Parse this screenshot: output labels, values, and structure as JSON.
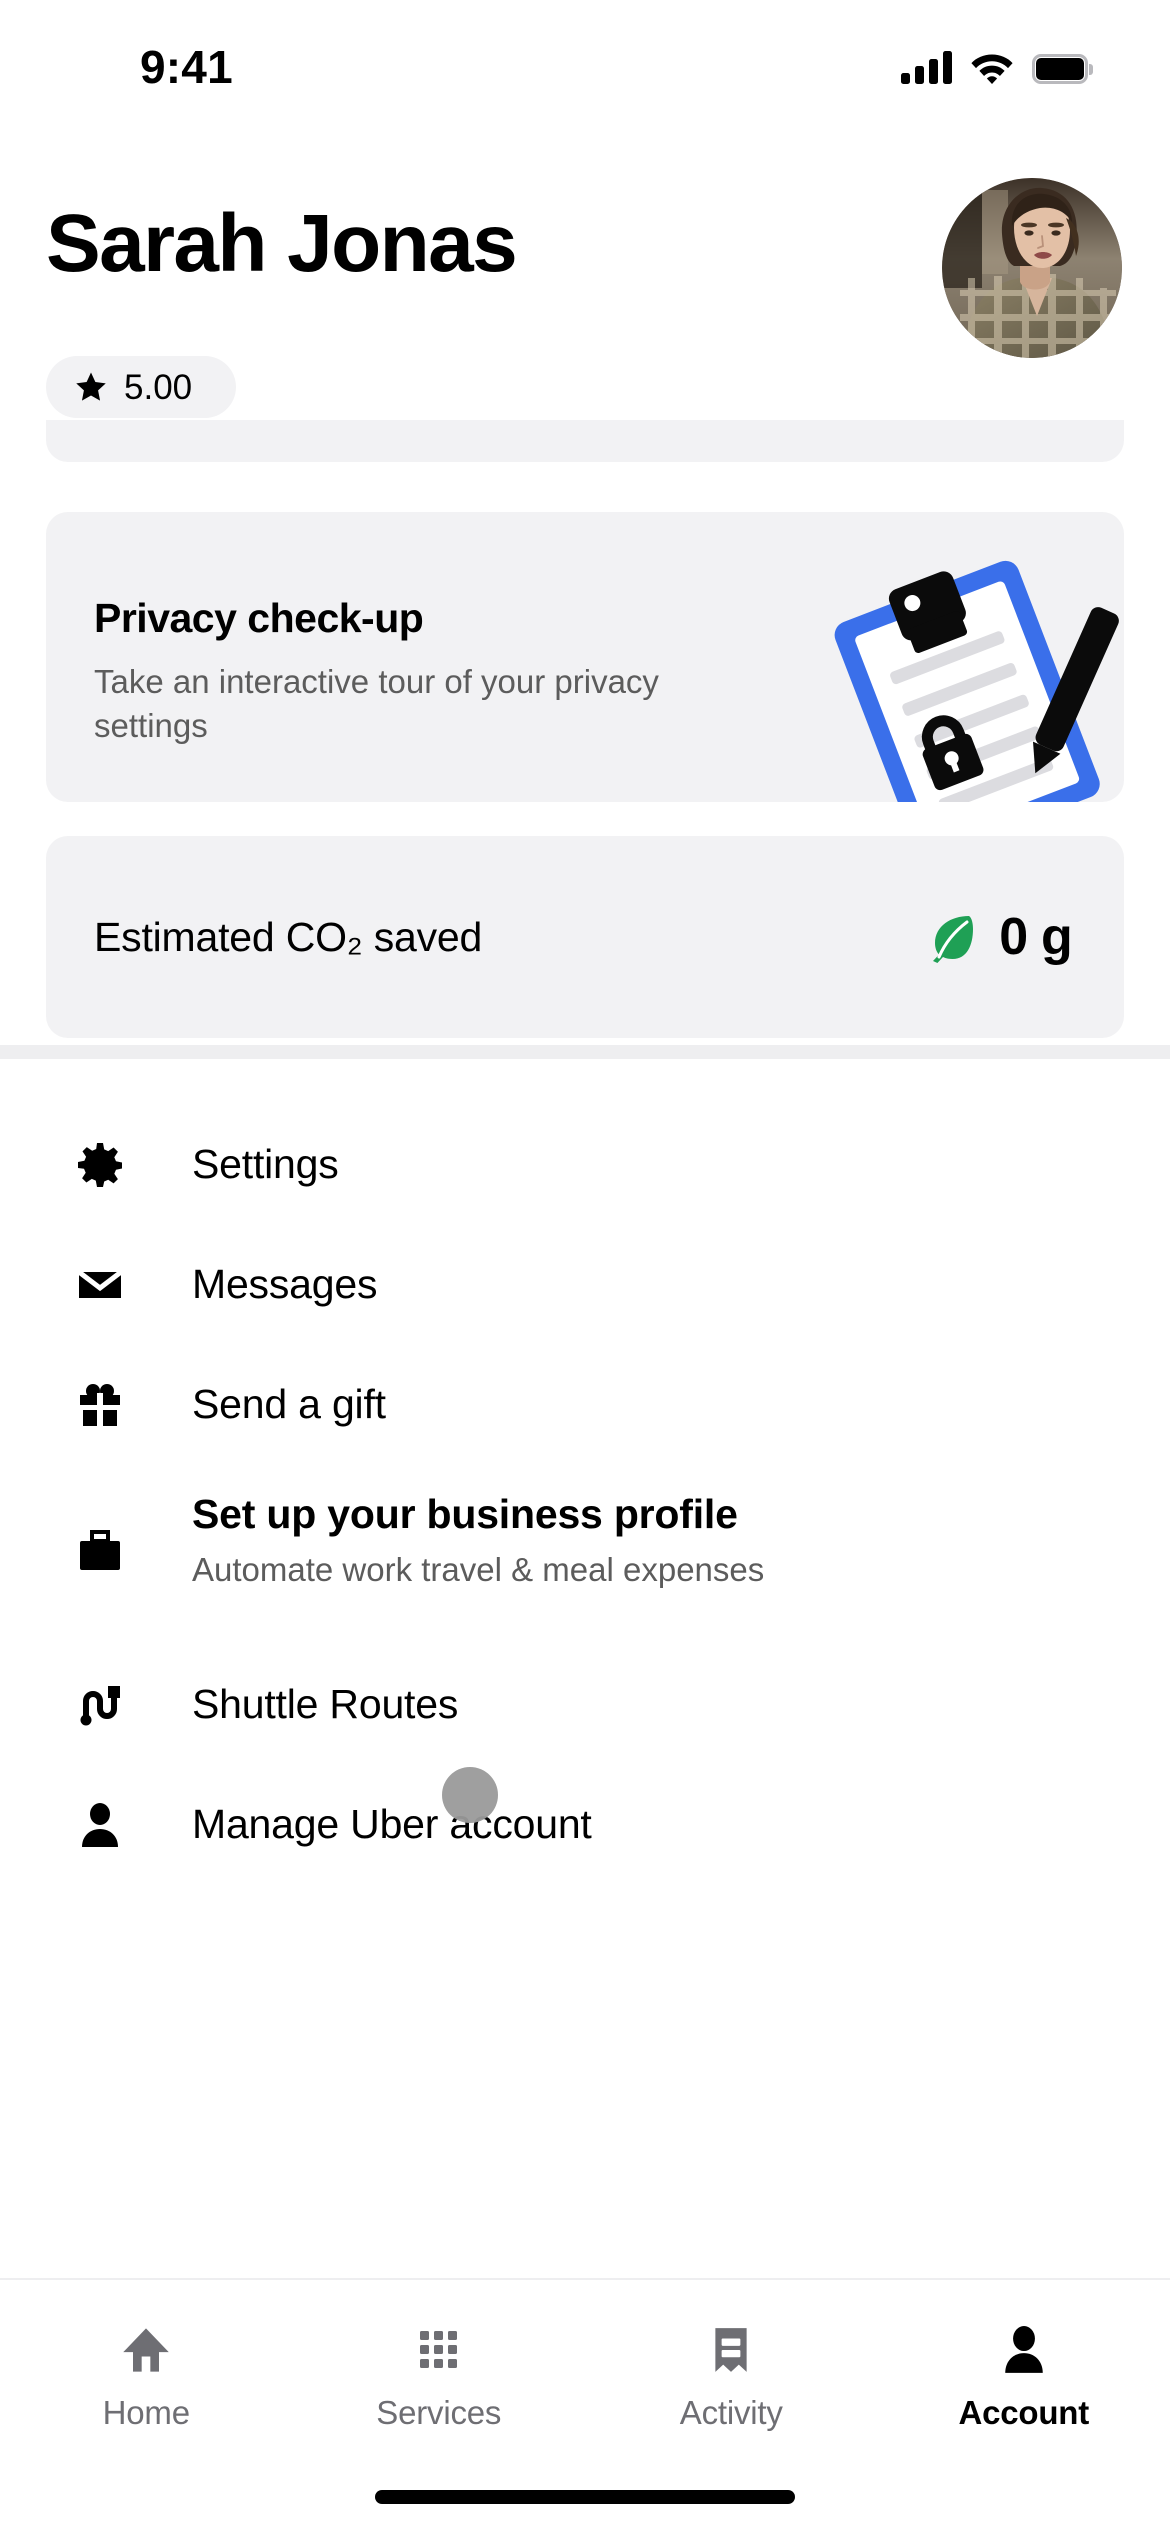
{
  "status_bar": {
    "time": "9:41",
    "cellular_icon": "cellular-signal-icon",
    "wifi_icon": "wifi-icon",
    "battery_icon": "battery-full-icon"
  },
  "header": {
    "user_name": "Sarah Jonas",
    "rating": "5.00",
    "star_icon": "star-icon",
    "avatar_alt": "profile-photo"
  },
  "cards": {
    "privacy": {
      "title": "Privacy check-up",
      "subtitle": "Take an interactive tour of your privacy settings",
      "illustration": "clipboard-lock-illustration",
      "accent_blue": "#3A6FEA",
      "paper_white": "#FFFFFF",
      "line_gray": "#DCDCE0"
    },
    "co2": {
      "label": "Estimated CO₂ saved",
      "value": "0 g",
      "leaf_icon": "leaf-icon",
      "leaf_color": "#1FA055"
    },
    "surface_color": "#F2F2F4"
  },
  "menu": {
    "items": [
      {
        "label": "Settings",
        "sub": "",
        "icon": "gear-icon",
        "bold": false
      },
      {
        "label": "Messages",
        "sub": "",
        "icon": "envelope-icon",
        "bold": false
      },
      {
        "label": "Send a gift",
        "sub": "",
        "icon": "gift-icon",
        "bold": false
      },
      {
        "label": "Set up your business profile",
        "sub": "Automate work travel & meal expenses",
        "icon": "briefcase-icon",
        "bold": true
      },
      {
        "label": "Shuttle Routes",
        "sub": "",
        "icon": "route-icon",
        "bold": false
      },
      {
        "label": "Manage Uber account",
        "sub": "",
        "icon": "person-icon",
        "bold": false
      }
    ]
  },
  "tabbar": {
    "items": [
      {
        "label": "Home",
        "icon": "home-icon",
        "active": false
      },
      {
        "label": "Services",
        "icon": "grid-icon",
        "active": false
      },
      {
        "label": "Activity",
        "icon": "receipt-icon",
        "active": false
      },
      {
        "label": "Account",
        "icon": "person-icon",
        "active": true
      }
    ],
    "inactive_color": "#6E6E73",
    "active_color": "#000000"
  },
  "system": {
    "home_indicator": "home-indicator",
    "cursor": "touch-cursor-indicator"
  }
}
